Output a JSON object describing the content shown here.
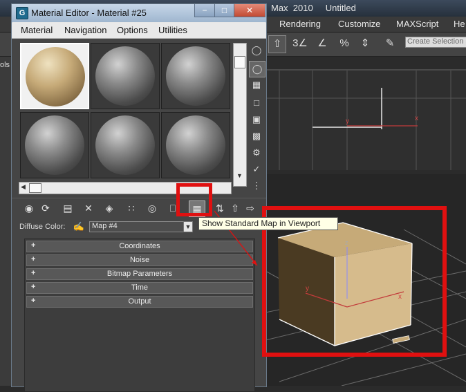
{
  "background_app": {
    "title": "Max  2010     Untitled",
    "menus": [
      "Rendering",
      "Customize",
      "MAXScript",
      "He"
    ],
    "selection_set_placeholder": "Create Selection S",
    "left_strip_text": "ols",
    "tool_icons": [
      "snaps-3d-icon",
      "angle-snap-icon",
      "percent-snap-icon",
      "spinner-snap-icon",
      "edit-named-selection-icon"
    ]
  },
  "window": {
    "title": "Material Editor - Material #25",
    "app_icon_letter": "G",
    "controls": {
      "minimize": "−",
      "maximize": "□",
      "close": "✕"
    }
  },
  "menu": [
    "Material",
    "Navigation",
    "Options",
    "Utilities"
  ],
  "sample_slots": [
    {
      "material": "tan-wood",
      "selected": true
    },
    {
      "material": "default-gray",
      "selected": false
    },
    {
      "material": "default-gray",
      "selected": false
    },
    {
      "material": "default-gray",
      "selected": false
    },
    {
      "material": "default-gray",
      "selected": false
    },
    {
      "material": "default-gray",
      "selected": false
    }
  ],
  "side_tools": [
    "sample-type-icon",
    "backlight-icon",
    "background-icon",
    "sample-uv-tiling-icon",
    "video-color-check-icon",
    "make-preview-icon",
    "options-icon",
    "select-by-material-icon",
    "material-map-navigator-icon"
  ],
  "toolbar": [
    "get-material-icon",
    "put-to-scene-icon",
    "assign-to-selection-icon",
    "reset-map-icon",
    "make-copy-icon",
    "put-to-library-icon",
    "material-id-channel-icon",
    "show-standard-map-icon",
    "show-end-result-icon",
    "go-to-parent-icon",
    "go-forward-sibling-icon"
  ],
  "diffuse": {
    "label": "Diffuse Color:",
    "map_name": "Map #4"
  },
  "rollouts": [
    {
      "symbol": "+",
      "label": "Coordinates"
    },
    {
      "symbol": "+",
      "label": "Noise"
    },
    {
      "symbol": "+",
      "label": "Bitmap Parameters"
    },
    {
      "symbol": "+",
      "label": "Time"
    },
    {
      "symbol": "+",
      "label": "Output"
    }
  ],
  "tooltip": "Show Standard Map in Viewport",
  "viewport": {
    "axis_labels": {
      "x": "x",
      "y": "y",
      "z": "z"
    }
  },
  "colors": {
    "highlight": "#e01010",
    "panel": "#454545",
    "wood": "#c6aa78"
  }
}
